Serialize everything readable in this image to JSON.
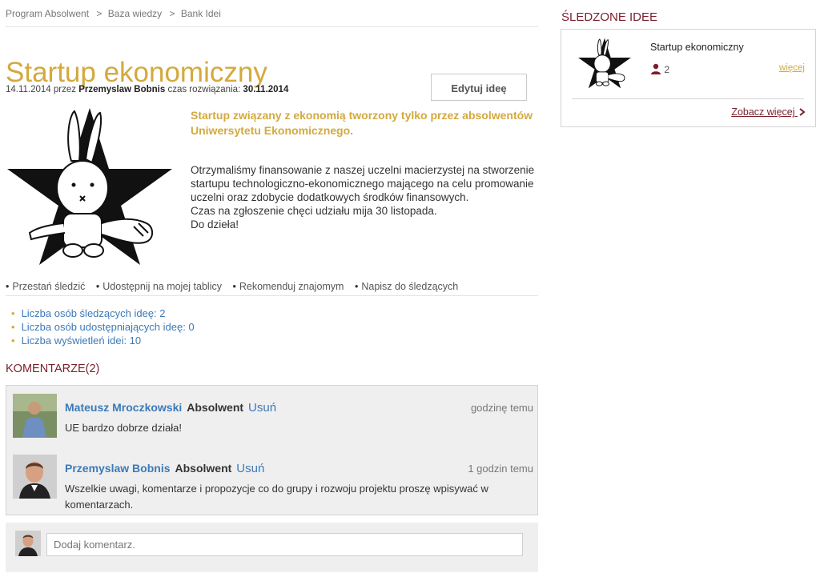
{
  "breadcrumb": {
    "items": [
      "Program Absolwent",
      "Baza wiedzy",
      "Bank Idei"
    ],
    "separator": ">"
  },
  "idea": {
    "title": "Startup ekonomiczny",
    "date": "14.11.2014",
    "by_label": "przez",
    "author": "Przemyslaw Bobnis",
    "deadline_label": "czas rozwiązania:",
    "deadline": "30.11.2014",
    "edit_label": "Edytuj ideę",
    "lead": "Startup związany z ekonomią tworzony tylko przez absolwentów Uniwersytetu Ekonomicznego.",
    "description_lines": [
      "Otrzymaliśmy finansowanie z naszej uczelni macierzystej na stworzenie startupu technologiczno-ekonomicznego mającego na celu promowanie uczelni oraz zdobycie dodatkowych środków finansowych.",
      "Czas na zgłoszenie chęci udziału mija 30 listopada.",
      "Do dzieła!"
    ]
  },
  "actions": {
    "bullet": "•",
    "items": [
      "Przestań śledzić",
      "Udostępnij na mojej tablicy",
      "Rekomenduj znajomym",
      "Napisz do śledzących"
    ]
  },
  "stats": {
    "followers": "Liczba osób śledzących ideę: 2",
    "shares": "Liczba osób udostępniających ideę: 0",
    "views": "Liczba wyświetleń idei: 10"
  },
  "comments": {
    "title": "KOMENTARZE(2)",
    "items": [
      {
        "author": "Mateusz Mroczkowski",
        "role": "Absolwent",
        "delete_label": "Usuń",
        "time": "godzinę temu",
        "text": "UE bardzo dobrze działa!"
      },
      {
        "author": "Przemyslaw Bobnis",
        "role": "Absolwent",
        "delete_label": "Usuń",
        "time": "1 godzin temu",
        "text": "Wszelkie uwagi, komentarze i propozycje co do grupy i rozwoju projektu proszę wpisywać w komentarzach."
      }
    ],
    "add_placeholder": "Dodaj komentarz."
  },
  "sidebar": {
    "title": "ŚLEDZONE IDEE",
    "idea_name": "Startup ekonomiczny",
    "followers_count": "2",
    "more_label": "więcej",
    "see_more_label": "Zobacz więcej"
  },
  "colors": {
    "accent_gold": "#d4a93d",
    "accent_maroon": "#7a1e2b",
    "link_blue": "#3b7ab8"
  }
}
